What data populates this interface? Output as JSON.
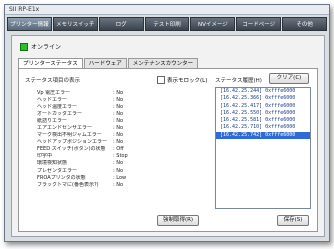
{
  "window": {
    "title": "SII RP-E1x"
  },
  "top_tabs": [
    "プリンター情報",
    "メモリスイッチ",
    "ログ",
    "テスト印刷",
    "NVイメージ",
    "コードページ",
    "その他"
  ],
  "status": {
    "label": "オンライン"
  },
  "sub_tabs": [
    "プリンターステータス",
    "ハードウェア",
    "メンテナンスカウンター"
  ],
  "status_header": "ステータス項目の表示",
  "show_colors_label": "表示モロック(L)",
  "history_header": "ステータス履歴(H)",
  "clear_button": "クリア(C)",
  "status_rows": [
    {
      "label": "Vp 電圧エラー",
      "value": ": No"
    },
    {
      "label": "ヘッドエラー",
      "value": ": No"
    },
    {
      "label": "ヘッド温度エラー",
      "value": ": No"
    },
    {
      "label": "オートカッタエラー",
      "value": ": No"
    },
    {
      "label": "紙詰りエラー",
      "value": ": No"
    },
    {
      "label": "エアエンドセンサエラー",
      "value": ": No"
    },
    {
      "label": "マーク検出不明ジャムエラー",
      "value": ": No"
    },
    {
      "label": "ヘッドアップポジションエラー",
      "value": ": No"
    },
    {
      "label": "FEED スイッチ(ボタン)の状態",
      "value": ": Off"
    },
    {
      "label": "印字中",
      "value": ": Stop"
    },
    {
      "label": "環境検知状態",
      "value": ": No"
    },
    {
      "label": "プレゼンタエラー",
      "value": ": No"
    },
    {
      "label": "FROAプリンタの状態",
      "value": ": Low"
    },
    {
      "label": "ブラックトマに(番色表示?)",
      "value": ": No"
    }
  ],
  "history": [
    "[16.42.25.244] 0xfffe6000",
    "[16.42.25.366] 0xfffe6000",
    "[16.42.25.417] 0xfffe6000",
    "[16.42.25.550] 0xfffe6000",
    "[16.42.25.581] 0xfffe6000",
    "[16.42.25.710] 0xfffe6000",
    "[16.42.25.742] 0xfffe6000"
  ],
  "selected_history_index": 6,
  "refresh_button": "強制取得(R)",
  "save_button": "保存(S)",
  "colors": {
    "tab_bg": "#3a434d",
    "selection": "#2f6bd8",
    "online": "#2bbf2b"
  }
}
